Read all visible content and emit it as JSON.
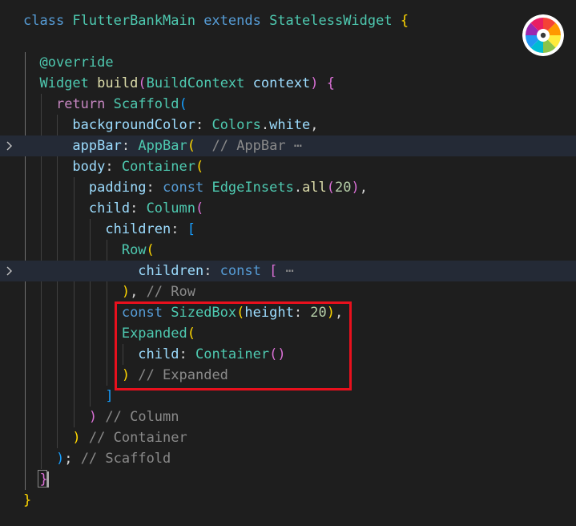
{
  "editor": {
    "lines": [
      [
        [
          "k",
          "class "
        ],
        [
          "t",
          "FlutterBankMain "
        ],
        [
          "k",
          "extends "
        ],
        [
          "t",
          "StatelessWidget "
        ],
        [
          "b1",
          "{"
        ]
      ],
      [],
      [
        [
          "o",
          "  "
        ],
        [
          "t",
          "@override"
        ]
      ],
      [
        [
          "o",
          "  "
        ],
        [
          "t",
          "Widget "
        ],
        [
          "f",
          "build"
        ],
        [
          "b2",
          "("
        ],
        [
          "t",
          "BuildContext "
        ],
        [
          "p",
          "context"
        ],
        [
          "b2",
          ")"
        ],
        [
          "o",
          " "
        ],
        [
          "b2",
          "{"
        ]
      ],
      [
        [
          "o",
          "    "
        ],
        [
          "r",
          "return "
        ],
        [
          "t",
          "Scaffold"
        ],
        [
          "b3",
          "("
        ]
      ],
      [
        [
          "o",
          "      "
        ],
        [
          "p",
          "backgroundColor"
        ],
        [
          "o",
          ": "
        ],
        [
          "t",
          "Colors"
        ],
        [
          "o",
          "."
        ],
        [
          "p",
          "white"
        ],
        [
          "o",
          ","
        ]
      ],
      [
        [
          "o",
          "      "
        ],
        [
          "p",
          "appBar"
        ],
        [
          "o",
          ": "
        ],
        [
          "t",
          "AppBar"
        ],
        [
          "b1",
          "("
        ],
        [
          "o",
          "  "
        ],
        [
          "c",
          "// AppBar"
        ],
        [
          "ell",
          " ⋯"
        ]
      ],
      [
        [
          "o",
          "      "
        ],
        [
          "p",
          "body"
        ],
        [
          "o",
          ": "
        ],
        [
          "t",
          "Container"
        ],
        [
          "b1",
          "("
        ]
      ],
      [
        [
          "o",
          "        "
        ],
        [
          "p",
          "padding"
        ],
        [
          "o",
          ": "
        ],
        [
          "k",
          "const "
        ],
        [
          "t",
          "EdgeInsets"
        ],
        [
          "o",
          "."
        ],
        [
          "f",
          "all"
        ],
        [
          "b2",
          "("
        ],
        [
          "n",
          "20"
        ],
        [
          "b2",
          ")"
        ],
        [
          "o",
          ","
        ]
      ],
      [
        [
          "o",
          "        "
        ],
        [
          "p",
          "child"
        ],
        [
          "o",
          ": "
        ],
        [
          "t",
          "Column"
        ],
        [
          "b2",
          "("
        ]
      ],
      [
        [
          "o",
          "          "
        ],
        [
          "p",
          "children"
        ],
        [
          "o",
          ": "
        ],
        [
          "b3",
          "["
        ]
      ],
      [
        [
          "o",
          "            "
        ],
        [
          "t",
          "Row"
        ],
        [
          "b1",
          "("
        ]
      ],
      [
        [
          "o",
          "              "
        ],
        [
          "p",
          "children"
        ],
        [
          "o",
          ": "
        ],
        [
          "k",
          "const "
        ],
        [
          "b2",
          "["
        ],
        [
          "ell",
          " ⋯"
        ]
      ],
      [
        [
          "o",
          "            "
        ],
        [
          "b1",
          ")"
        ],
        [
          "o",
          ", "
        ],
        [
          "c",
          "// Row"
        ]
      ],
      [
        [
          "o",
          "            "
        ],
        [
          "k",
          "const "
        ],
        [
          "t",
          "SizedBox"
        ],
        [
          "b1",
          "("
        ],
        [
          "p",
          "height"
        ],
        [
          "o",
          ": "
        ],
        [
          "n",
          "20"
        ],
        [
          "b1",
          ")"
        ],
        [
          "o",
          ","
        ]
      ],
      [
        [
          "o",
          "            "
        ],
        [
          "t",
          "Expanded"
        ],
        [
          "b1",
          "("
        ]
      ],
      [
        [
          "o",
          "              "
        ],
        [
          "p",
          "child"
        ],
        [
          "o",
          ": "
        ],
        [
          "t",
          "Container"
        ],
        [
          "b2",
          "()"
        ]
      ],
      [
        [
          "o",
          "            "
        ],
        [
          "b1",
          ")"
        ],
        [
          "o",
          " "
        ],
        [
          "c",
          "// Expanded"
        ]
      ],
      [
        [
          "o",
          "          "
        ],
        [
          "b3",
          "]"
        ]
      ],
      [
        [
          "o",
          "        "
        ],
        [
          "b2",
          ")"
        ],
        [
          "o",
          " "
        ],
        [
          "c",
          "// Column"
        ]
      ],
      [
        [
          "o",
          "      "
        ],
        [
          "b1",
          ")"
        ],
        [
          "o",
          " "
        ],
        [
          "c",
          "// Container"
        ]
      ],
      [
        [
          "o",
          "    "
        ],
        [
          "b3",
          ")"
        ],
        [
          "o",
          "; "
        ],
        [
          "c",
          "// Scaffold"
        ]
      ],
      [
        [
          "o",
          "  "
        ],
        [
          "b2",
          "}"
        ]
      ],
      [
        [
          "b1",
          "}"
        ]
      ]
    ],
    "folded_lines": [
      6,
      12
    ]
  },
  "colors": {
    "background": "#1e1e1e",
    "highlight_border": "#e8101d",
    "folded_line_bg": "#242a36"
  },
  "icons": {
    "fold": "chevron-right-icon",
    "widget": "color-wheel-icon"
  }
}
